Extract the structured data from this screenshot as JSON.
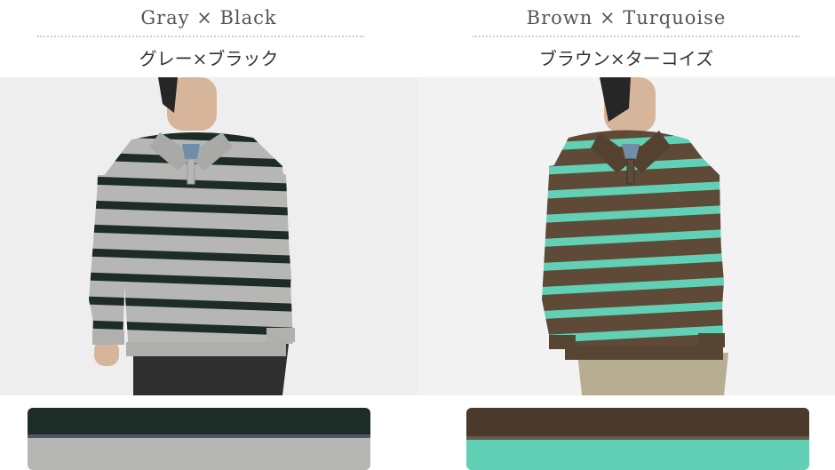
{
  "products": [
    {
      "color_en": "Gray × Black",
      "color_jp": "グレー×ブラック",
      "colors": {
        "body": "#b6b7b5",
        "stripe": "#1e2c27",
        "photo_bg": "#f1f1f1",
        "skin": "#d7b59b",
        "hair": "#262626",
        "pants": "#2f2f30",
        "inner": "#6f8ea8"
      }
    },
    {
      "color_en": "Brown × Turquoise",
      "color_jp": "ブラウン×ターコイズ",
      "colors": {
        "body": "#5e4a37",
        "stripe": "#62d0b5",
        "photo_bg": "#f1f1f1",
        "skin": "#d7b59b",
        "hair": "#262626",
        "pants": "#b7ad93",
        "inner": "#6f8ea8"
      }
    }
  ]
}
